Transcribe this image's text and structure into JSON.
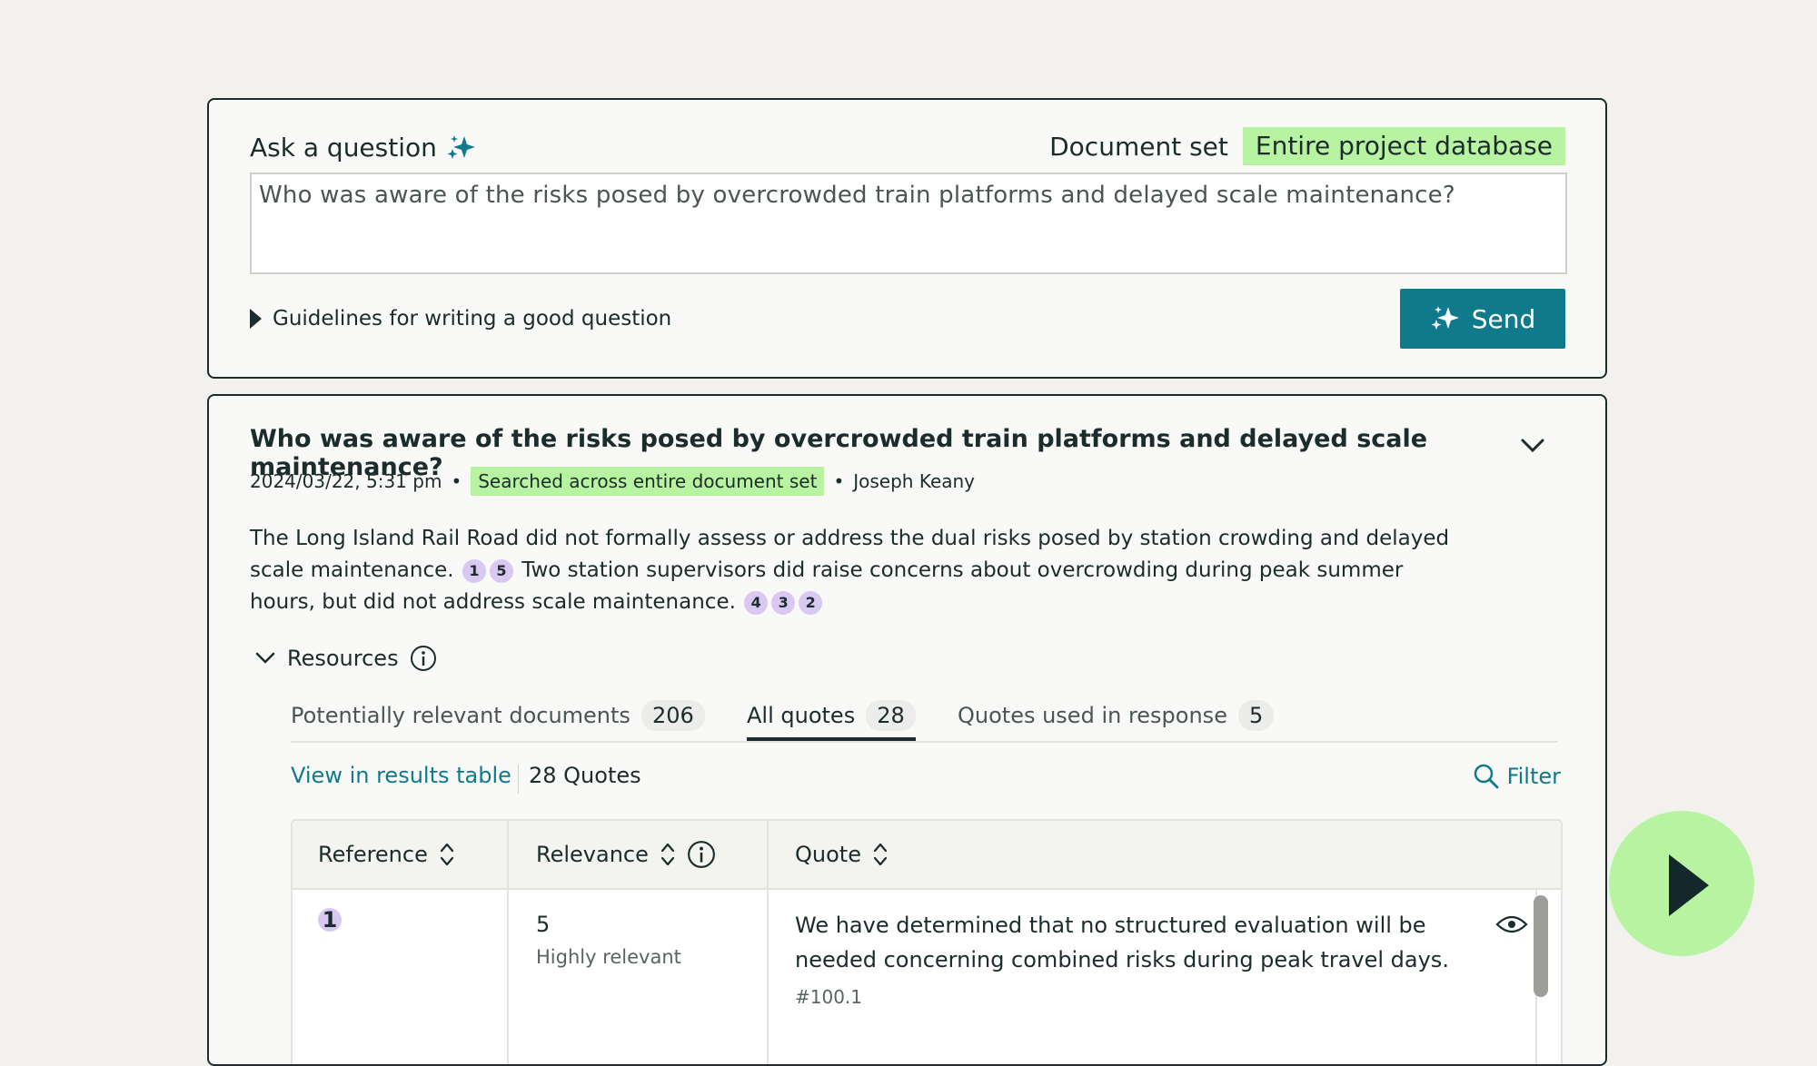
{
  "ask": {
    "title": "Ask a question",
    "docset_label": "Document set",
    "docset_value": "Entire project database",
    "question_value": "Who was aware of the risks posed by overcrowded train platforms and delayed scale maintenance?",
    "guidelines": "Guidelines for writing a good question",
    "send_label": "Send"
  },
  "answer": {
    "question": "Who was aware of the risks posed by overcrowded train platforms and delayed scale maintenance?",
    "timestamp": "2024/03/22, 5:31 pm",
    "search_scope": "Searched across entire document set",
    "author": "Joseph Keany",
    "text_part1": "The Long Island Rail Road did not formally assess or address the dual risks posed by station crowding and delayed scale maintenance.",
    "text_part2": "Two station supervisors did raise concerns about overcrowding during peak summer hours, but did not address scale maintenance.",
    "citations_1": [
      "1",
      "5"
    ],
    "citations_2": [
      "4",
      "3",
      "2"
    ]
  },
  "resources": {
    "label": "Resources",
    "tabs": [
      {
        "label": "Potentially relevant documents",
        "count": "206"
      },
      {
        "label": "All quotes",
        "count": "28"
      },
      {
        "label": "Quotes used in response",
        "count": "5"
      }
    ],
    "view_link": "View in results table",
    "quotes_count": "28 Quotes",
    "filter_label": "Filter"
  },
  "table": {
    "headers": [
      "Reference",
      "Relevance",
      "Quote"
    ],
    "rows": [
      {
        "reference": "1",
        "relevance_score": "5",
        "relevance_label": "Highly relevant",
        "quote": "We have determined that no structured evaluation will be needed concerning combined risks during peak travel days.",
        "quote_id": "#100.1"
      }
    ]
  },
  "colors": {
    "accent": "#0e7a8c",
    "highlight": "#b8f3a2",
    "citation": "#d9c8f2",
    "text": "#1c2b2b"
  }
}
